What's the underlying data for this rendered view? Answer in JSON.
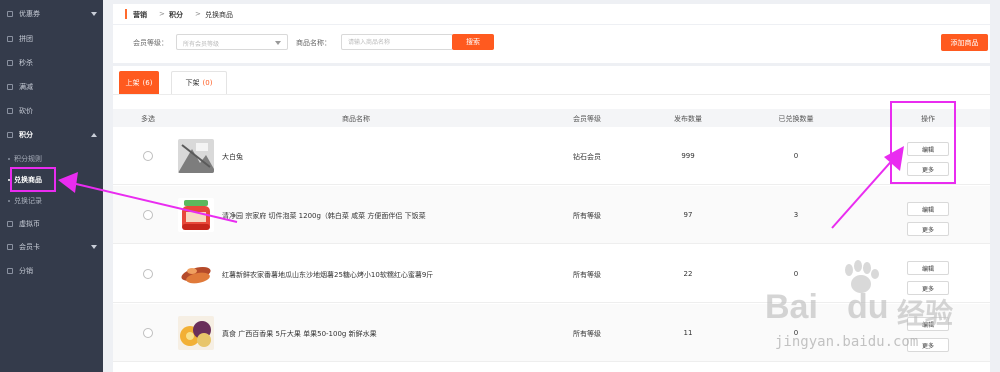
{
  "sidebar": {
    "items": [
      {
        "label": "优惠券",
        "arrow": "down"
      },
      {
        "label": "拼团"
      },
      {
        "label": "秒杀"
      },
      {
        "label": "满减"
      },
      {
        "label": "砍价"
      },
      {
        "label": "积分",
        "arrow": "up"
      },
      {
        "label": "积分规则"
      },
      {
        "label": "兑换商品"
      },
      {
        "label": "兑换记录"
      },
      {
        "label": "虚拟币"
      },
      {
        "label": "会员卡",
        "arrow": "down"
      },
      {
        "label": "分销"
      }
    ]
  },
  "breadcrumb": {
    "items": [
      "营销",
      "积分",
      "兑换商品"
    ],
    "separator": ">"
  },
  "filter": {
    "level_label": "会员等级：",
    "level_value": "所有会员等级",
    "name_label": "商品名称：",
    "name_placeholder": "请输入商品名称",
    "search_button": "搜索",
    "add_button": "添加商品"
  },
  "tabs": [
    {
      "label": "上架",
      "count": "(6)"
    },
    {
      "label": "下架",
      "count": "(0)"
    }
  ],
  "table": {
    "headers": [
      "多选",
      "商品名称",
      "会员等级",
      "发布数量",
      "已兑换数量",
      "操作"
    ],
    "rows": [
      {
        "name": "大白兔",
        "level": "钻石会员",
        "published": "999",
        "exchanged": "0",
        "edit": "编辑",
        "more": "更多"
      },
      {
        "name": "清净园 宗家府 切件泡菜 1200g（韩白菜 咸菜 方便面伴侣 下饭菜",
        "level": "所有等级",
        "published": "97",
        "exchanged": "3",
        "edit": "编辑",
        "more": "更多"
      },
      {
        "name": "红薯新鲜农家番薯地瓜山东沙地烟薯25糖心烤小10软糯红心蜜薯9斤",
        "level": "所有等级",
        "published": "22",
        "exchanged": "0",
        "edit": "编辑",
        "more": "更多"
      },
      {
        "name": "真食 广西百香果 5斤大果 单果50-100g 新鲜水果",
        "level": "所有等级",
        "published": "11",
        "exchanged": "0",
        "edit": "编辑",
        "more": "更多"
      }
    ]
  },
  "watermark": {
    "brand_left": "Bai",
    "brand_right": "du",
    "brand_cn": "经验",
    "url": "jingyan.baidu.com"
  },
  "colors": {
    "accent": "#ff5a1f",
    "sidebar_bg": "#343b4b",
    "highlight": "#e92cf0"
  }
}
